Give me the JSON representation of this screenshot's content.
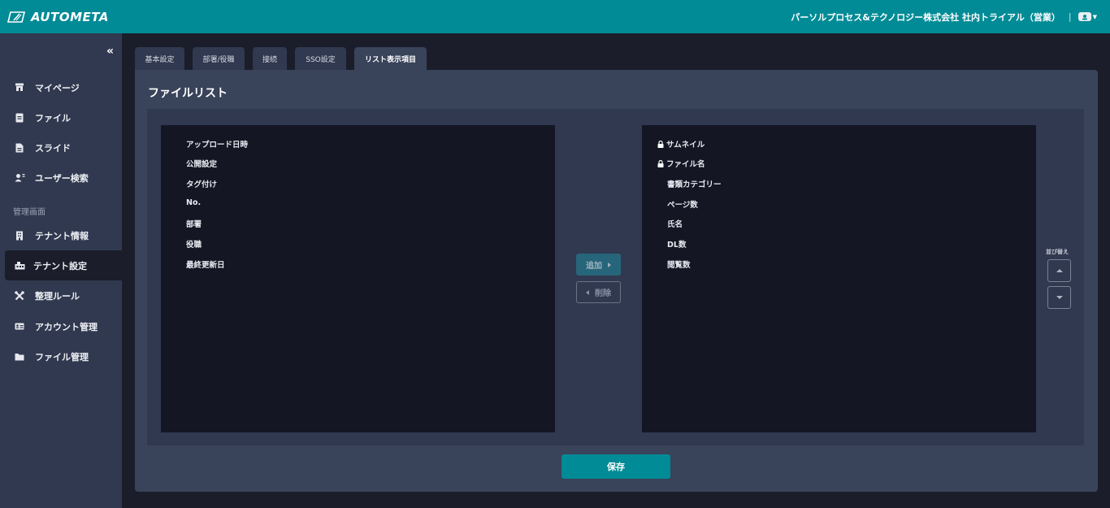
{
  "app": {
    "logo_text": "AUTOMETA",
    "tenant_name": "パーソルプロセス&テクノロジー株式会社 社内トライアル（営業）",
    "separator": "|",
    "brand_color": "#008b96"
  },
  "sidebar": {
    "collapse_icon": "«",
    "section_label": "管理画面",
    "items": [
      {
        "label": "マイページ",
        "icon": "store-icon"
      },
      {
        "label": "ファイル",
        "icon": "file-icon"
      },
      {
        "label": "スライド",
        "icon": "document-icon"
      },
      {
        "label": "ユーザー検索",
        "icon": "user-search-icon"
      },
      {
        "label": "テナント情報",
        "icon": "building-icon"
      },
      {
        "label": "テナント設定",
        "icon": "tenant-settings-icon",
        "active": true
      },
      {
        "label": "整理ルール",
        "icon": "tools-icon"
      },
      {
        "label": "アカウント管理",
        "icon": "id-card-icon"
      },
      {
        "label": "ファイル管理",
        "icon": "folder-icon"
      }
    ]
  },
  "tabs": [
    {
      "label": "基本設定"
    },
    {
      "label": "部署/役職"
    },
    {
      "label": "接続"
    },
    {
      "label": "SSO設定"
    },
    {
      "label": "リスト表示項目",
      "active": true
    }
  ],
  "main": {
    "title": "ファイルリスト",
    "available_items": [
      "アップロード日時",
      "公開設定",
      "タグ付け",
      "No.",
      "部署",
      "役職",
      "最終更新日"
    ],
    "selected_items": [
      {
        "label": "サムネイル",
        "locked": true
      },
      {
        "label": "ファイル名",
        "locked": true
      },
      {
        "label": "書類カテゴリー",
        "locked": false
      },
      {
        "label": "ページ数",
        "locked": false
      },
      {
        "label": "氏名",
        "locked": false
      },
      {
        "label": "DL数",
        "locked": false
      },
      {
        "label": "閲覧数",
        "locked": false
      }
    ],
    "add_label": "追加",
    "remove_label": "削除",
    "sort_label": "並び替え",
    "save_label": "保存"
  }
}
